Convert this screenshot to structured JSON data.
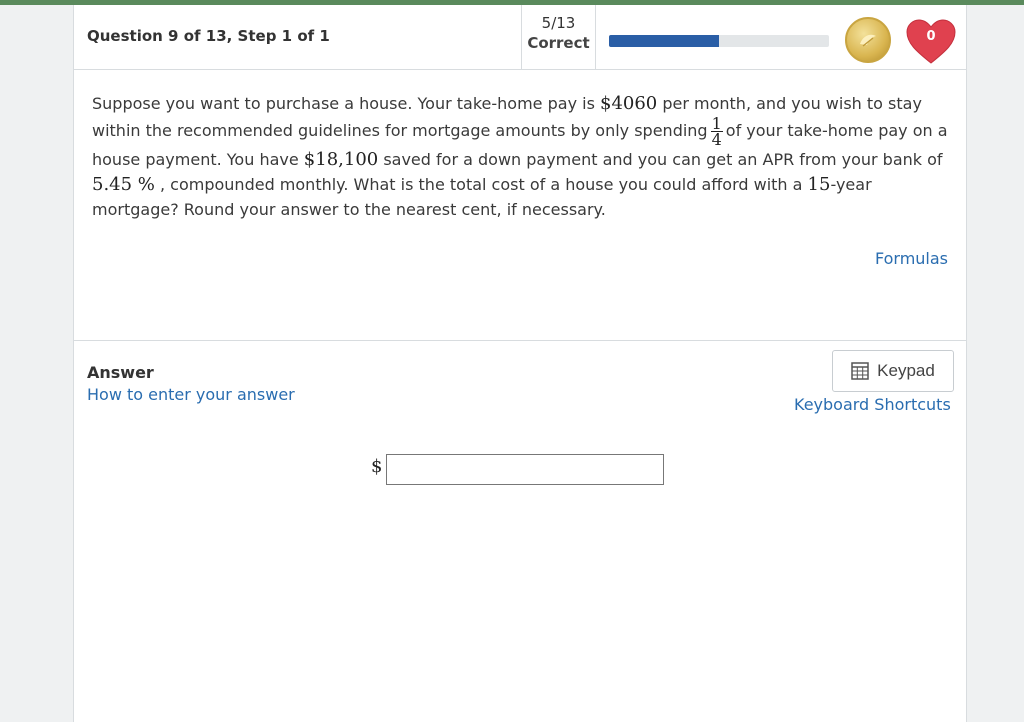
{
  "header": {
    "question_label": "Question 9 of 13, Step 1 of 1",
    "score_fraction": "5/13",
    "score_label": "Correct",
    "progress_fraction": 0.5,
    "hearts_count": "0"
  },
  "question": {
    "t1": "Suppose you want to purchase a house. Your take-home pay is ",
    "m1": "$4060",
    "t2": " per month, and you wish to stay within the recommended guidelines for mortgage amounts by only spending",
    "frac_num": "1",
    "frac_den": "4",
    "t3": "of your take-home pay on a house payment. You have ",
    "m2": "$18,100",
    "t4": " saved for a down payment and you can get an APR from your bank of ",
    "m3": "5.45 %",
    "t5": " , compounded monthly. What is the total cost of a house you could afford with a ",
    "m4": "15",
    "t6": "-year mortgage? Round your answer to the nearest cent, if necessary."
  },
  "links": {
    "formulas": "Formulas",
    "how_to": "How to enter your answer",
    "keyboard_shortcuts": "Keyboard Shortcuts"
  },
  "answer": {
    "title": "Answer",
    "keypad_label": "Keypad",
    "currency_symbol": "$",
    "value": ""
  },
  "colors": {
    "accent_blue": "#2a5ea6",
    "link_blue": "#2a6db0",
    "heart_red": "#e0414f",
    "coin_gold": "#d9b550"
  },
  "icons": [
    "coin-icon",
    "heart-icon",
    "keypad-icon"
  ]
}
